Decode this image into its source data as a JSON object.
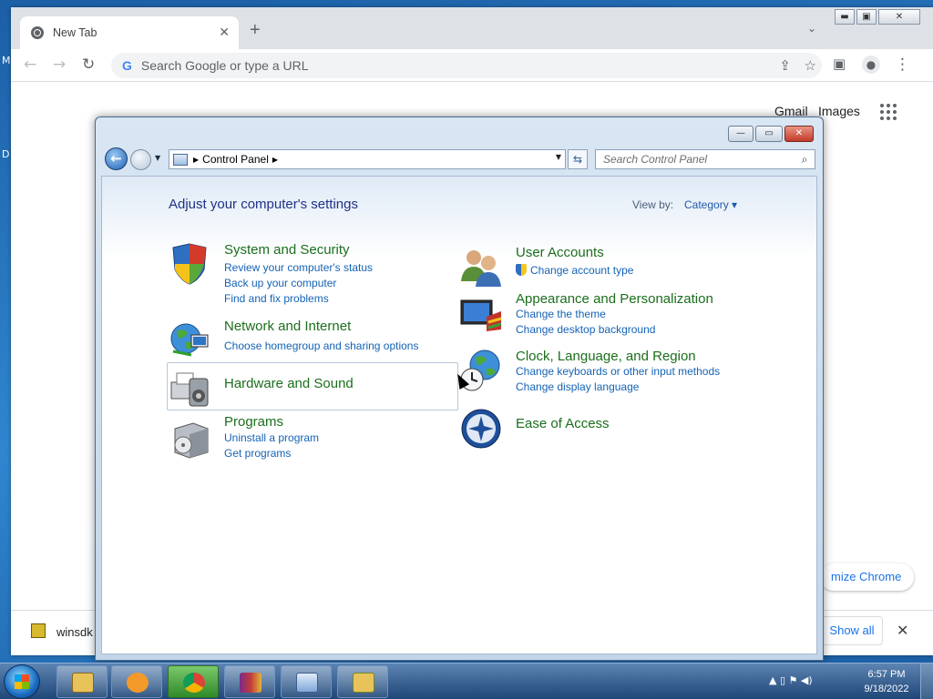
{
  "chrome": {
    "tab_title": "New Tab",
    "tab_close": "✕",
    "new_tab": "+",
    "tab_search": "⌄",
    "omnibox_placeholder": "Search Google or type a URL",
    "google_g": "G",
    "back": "←",
    "forward": "→",
    "reload": "↻",
    "share": "⇪",
    "bookmark": "☆",
    "side_panel": "▣",
    "profile": "●",
    "menu": "⋮",
    "window_minimize": "▬",
    "window_restore": "▣",
    "window_close": "✕",
    "gmail": "Gmail",
    "images": "Images",
    "customize": "mize Chrome",
    "download_name": "winsdk",
    "show_all": "Show all",
    "download_close": "✕"
  },
  "desktop": {
    "edge_glyphs": [
      "M",
      "D"
    ]
  },
  "control_panel": {
    "window_buttons": {
      "minimize": "—",
      "restore": "▭",
      "close": "✕"
    },
    "breadcrumb": "Control Panel",
    "search_placeholder": "Search Control Panel",
    "heading": "Adjust your computer's settings",
    "view_by_label": "View by:",
    "view_by_value": "Category ▾",
    "categories": [
      {
        "title": "System and Security",
        "links": [
          "Review your computer's status",
          "Back up your computer",
          "Find and fix problems"
        ]
      },
      {
        "title": "Network and Internet",
        "links": [
          "Choose homegroup and sharing options"
        ]
      },
      {
        "title": "Hardware and Sound",
        "links": []
      },
      {
        "title": "Programs",
        "links": [
          "Uninstall a program",
          "Get programs"
        ]
      },
      {
        "title": "User Accounts",
        "links": [
          "Change account type"
        ]
      },
      {
        "title": "Appearance and Personalization",
        "links": [
          "Change the theme",
          "Change desktop background"
        ]
      },
      {
        "title": "Clock, Language, and Region",
        "links": [
          "Change keyboards or other input methods",
          "Change display language"
        ]
      },
      {
        "title": "Ease of Access",
        "links": []
      }
    ]
  },
  "taskbar": {
    "items": [
      "explorer",
      "media-player",
      "chrome",
      "winrar",
      "control-panel",
      "sync-folder"
    ],
    "active": "chrome",
    "tray_glyphs": "▲  ▯  ⚑  ◀)",
    "time": "6:57 PM",
    "date": "9/18/2022"
  },
  "colors": {
    "category_title": "#1b6e1c",
    "link": "#1563b5",
    "heading": "#1e3287"
  }
}
